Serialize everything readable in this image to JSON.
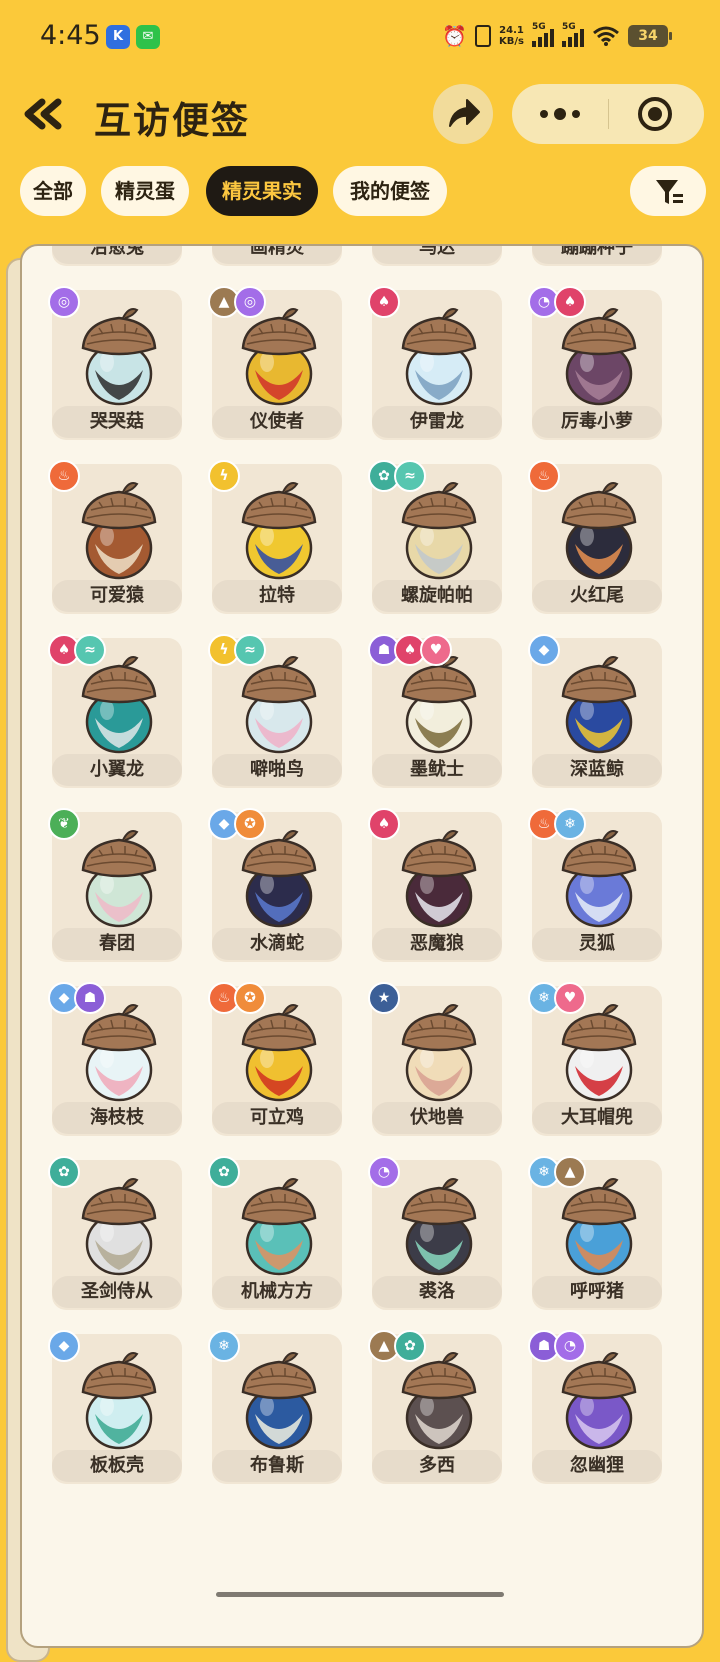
{
  "status_bar": {
    "time": "4:45",
    "net_speed_value": "24.1",
    "net_speed_unit": "KB/s",
    "sim1": "5G",
    "sim2": "5G",
    "battery": "34"
  },
  "header": {
    "title": "互访便签"
  },
  "filters": [
    {
      "label": "全部",
      "active": false
    },
    {
      "label": "精灵蛋",
      "active": false
    },
    {
      "label": "精灵果实",
      "active": true
    },
    {
      "label": "我的便签",
      "active": false
    }
  ],
  "colors": {
    "background": "#fbc93a",
    "active_chip": "#1f1a14",
    "active_chip_text": "#fcc740",
    "fire": "#ef6a3a",
    "electric": "#f2c12e",
    "water": "#6aa8e8",
    "psychic": "#a36de8",
    "rock": "#9c7a52",
    "flying": "#56c6b0",
    "evil": "#e0436a",
    "mech": "#3fae9a",
    "grass": "#4caf58",
    "fairy": "#ef6f96",
    "ghost": "#8b5ed7",
    "light": "#3c5f97",
    "ice": "#6ab3e3",
    "cute": "#ee6a8c",
    "martial": "#f08c3a"
  },
  "items": [
    {
      "name": "治愈兔",
      "types": [],
      "cap": "#a37755",
      "body": "#f4ecec",
      "accent": "#e05040"
    },
    {
      "name": "画精灵",
      "types": [],
      "cap": "#8b6a48",
      "body": "#5c4c40",
      "accent": "#8ed0e0"
    },
    {
      "name": "乌达",
      "types": [],
      "cap": "#a37755",
      "body": "#c9202e",
      "accent": "#e8dcdc"
    },
    {
      "name": "蹦蹦种子",
      "types": [],
      "cap": "#a37755",
      "body": "#3c9a4e",
      "accent": "#2a2a2a"
    },
    {
      "name": "哭哭菇",
      "types": [
        {
          "t": "psychic",
          "icon": "◎"
        }
      ],
      "cap": "#a37755",
      "body": "#c8e4e6",
      "accent": "#2c2c2c"
    },
    {
      "name": "仪使者",
      "types": [
        {
          "t": "rock",
          "icon": "▲"
        },
        {
          "t": "psychic",
          "icon": "◎"
        }
      ],
      "cap": "#a37755",
      "body": "#e8b830",
      "accent": "#d0302a"
    },
    {
      "name": "伊雷龙",
      "types": [
        {
          "t": "evil",
          "icon": "♠"
        }
      ],
      "cap": "#a37755",
      "body": "#d6ecf6",
      "accent": "#7aa0c0"
    },
    {
      "name": "厉毒小萝",
      "types": [
        {
          "t": "psychic",
          "icon": "◔"
        },
        {
          "t": "evil",
          "icon": "♠"
        }
      ],
      "cap": "#a37755",
      "body": "#6c4666",
      "accent": "#a88098"
    },
    {
      "name": "可爱猿",
      "types": [
        {
          "t": "fire",
          "icon": "♨"
        }
      ],
      "cap": "#a37755",
      "body": "#a45a32",
      "accent": "#f0e0c8"
    },
    {
      "name": "拉特",
      "types": [
        {
          "t": "electric",
          "icon": "ϟ"
        }
      ],
      "cap": "#a37755",
      "body": "#f0c830",
      "accent": "#2a4aa8"
    },
    {
      "name": "螺旋帕帕",
      "types": [
        {
          "t": "mech",
          "icon": "✿"
        },
        {
          "t": "flying",
          "icon": "≈"
        }
      ],
      "cap": "#a37755",
      "body": "#e8d8a8",
      "accent": "#c0c8cc"
    },
    {
      "name": "火红尾",
      "types": [
        {
          "t": "fire",
          "icon": "♨"
        }
      ],
      "cap": "#a37755",
      "body": "#2c2c3c",
      "accent": "#e89050"
    },
    {
      "name": "小翼龙",
      "types": [
        {
          "t": "evil",
          "icon": "♠"
        },
        {
          "t": "flying",
          "icon": "≈"
        }
      ],
      "cap": "#a37755",
      "body": "#2a9a98",
      "accent": "#e0e8e8"
    },
    {
      "name": "噼啪鸟",
      "types": [
        {
          "t": "electric",
          "icon": "ϟ"
        },
        {
          "t": "flying",
          "icon": "≈"
        }
      ],
      "cap": "#a37755",
      "body": "#d8e8ec",
      "accent": "#f0b0c8"
    },
    {
      "name": "墨鱿士",
      "types": [
        {
          "t": "ghost",
          "icon": "☗"
        },
        {
          "t": "evil",
          "icon": "♠"
        },
        {
          "t": "cute",
          "icon": "♥"
        }
      ],
      "cap": "#a37755",
      "body": "#f2eedc",
      "accent": "#7a6a3a"
    },
    {
      "name": "深蓝鲸",
      "types": [
        {
          "t": "water",
          "icon": "◆"
        }
      ],
      "cap": "#a37755",
      "body": "#2a4aa0",
      "accent": "#f0c830"
    },
    {
      "name": "春团",
      "types": [
        {
          "t": "grass",
          "icon": "❦"
        }
      ],
      "cap": "#a37755",
      "body": "#cfe6d6",
      "accent": "#f0b8c8"
    },
    {
      "name": "水滴蛇",
      "types": [
        {
          "t": "water",
          "icon": "◆"
        },
        {
          "t": "martial",
          "icon": "✪"
        }
      ],
      "cap": "#a37755",
      "body": "#2c2c4c",
      "accent": "#5a7ad0"
    },
    {
      "name": "恶魔狼",
      "types": [
        {
          "t": "evil",
          "icon": "♠"
        }
      ],
      "cap": "#a37755",
      "body": "#4a2a3a",
      "accent": "#e8e8f0"
    },
    {
      "name": "灵狐",
      "types": [
        {
          "t": "fire",
          "icon": "♨"
        },
        {
          "t": "ice",
          "icon": "❄"
        }
      ],
      "cap": "#a37755",
      "body": "#6a7ad8",
      "accent": "#e8eef8"
    },
    {
      "name": "海枝枝",
      "types": [
        {
          "t": "water",
          "icon": "◆"
        },
        {
          "t": "ghost",
          "icon": "☗"
        }
      ],
      "cap": "#a37755",
      "body": "#e8f4f6",
      "accent": "#f0a8b8"
    },
    {
      "name": "可立鸡",
      "types": [
        {
          "t": "fire",
          "icon": "♨"
        },
        {
          "t": "martial",
          "icon": "✪"
        }
      ],
      "cap": "#a37755",
      "body": "#f0c030",
      "accent": "#d03020"
    },
    {
      "name": "伏地兽",
      "types": [
        {
          "t": "light",
          "icon": "★"
        }
      ],
      "cap": "#a37755",
      "body": "#f0dcb8",
      "accent": "#d8a090"
    },
    {
      "name": "大耳帽兜",
      "types": [
        {
          "t": "ice",
          "icon": "❄"
        },
        {
          "t": "cute",
          "icon": "♥"
        }
      ],
      "cap": "#a37755",
      "body": "#f0f0f0",
      "accent": "#d02028"
    },
    {
      "name": "圣剑侍从",
      "types": [
        {
          "t": "mech",
          "icon": "✿"
        }
      ],
      "cap": "#a37755",
      "body": "#e0e0e0",
      "accent": "#b0a890"
    },
    {
      "name": "机械方方",
      "types": [
        {
          "t": "mech",
          "icon": "✿"
        }
      ],
      "cap": "#a37755",
      "body": "#5ac0b8",
      "accent": "#e09060"
    },
    {
      "name": "裘洛",
      "types": [
        {
          "t": "psychic",
          "icon": "◔"
        }
      ],
      "cap": "#a37755",
      "body": "#3c3c48",
      "accent": "#88d8c0"
    },
    {
      "name": "呼呼猪",
      "types": [
        {
          "t": "ice",
          "icon": "❄"
        },
        {
          "t": "rock",
          "icon": "▲"
        }
      ],
      "cap": "#a37755",
      "body": "#4aa0d8",
      "accent": "#e08850"
    },
    {
      "name": "板板壳",
      "types": [
        {
          "t": "water",
          "icon": "◆"
        }
      ],
      "cap": "#a37755",
      "body": "#cfeef0",
      "accent": "#3aa890"
    },
    {
      "name": "布鲁斯",
      "types": [
        {
          "t": "ice",
          "icon": "❄"
        }
      ],
      "cap": "#a37755",
      "body": "#2c5aa0",
      "accent": "#f0f0e0"
    },
    {
      "name": "多西",
      "types": [
        {
          "t": "rock",
          "icon": "▲"
        },
        {
          "t": "mech",
          "icon": "✿"
        }
      ],
      "cap": "#a37755",
      "body": "#5c5050",
      "accent": "#e0d8d0"
    },
    {
      "name": "忽幽狸",
      "types": [
        {
          "t": "ghost",
          "icon": "☗"
        },
        {
          "t": "psychic",
          "icon": "◔"
        }
      ],
      "cap": "#a37755",
      "body": "#7a58c8",
      "accent": "#d8c8f0"
    }
  ]
}
